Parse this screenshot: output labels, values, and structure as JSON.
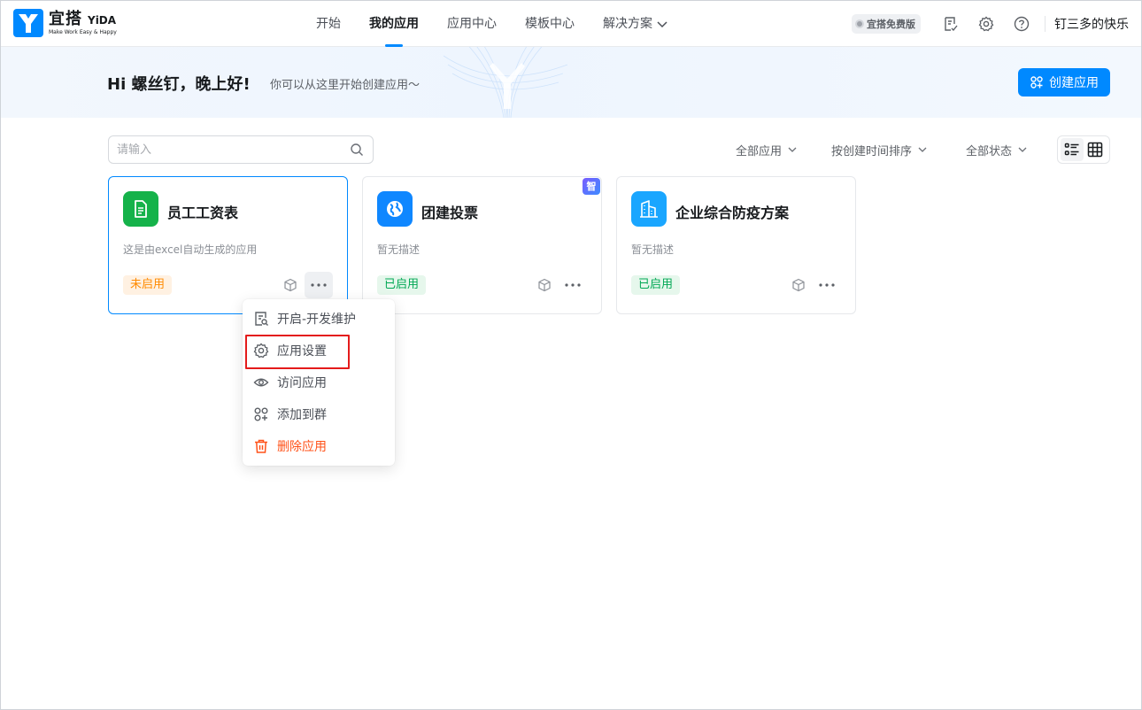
{
  "brand": {
    "name_cn": "宜搭",
    "name_en": "YiDA",
    "slogan": "Make Work Easy & Happy",
    "logo_icon": "yida-logo-icon",
    "accent_color": "#0089ff"
  },
  "nav": {
    "items": [
      {
        "label": "开始"
      },
      {
        "label": "我的应用"
      },
      {
        "label": "应用中心"
      },
      {
        "label": "模板中心"
      },
      {
        "label": "解决方案"
      }
    ],
    "active_index": 1
  },
  "topright": {
    "free_badge": "宜搭免费版",
    "icons": [
      "todo-icon",
      "settings-icon",
      "help-icon"
    ],
    "user_name": "钉三多的快乐"
  },
  "banner": {
    "greeting": "Hi 螺丝钉，晚上好!",
    "subtitle": "你可以从这里开始创建应用～",
    "create_button": "创建应用"
  },
  "toolbar": {
    "search_placeholder": "请输入",
    "filter_apps": "全部应用",
    "sort": "按创建时间排序",
    "filter_status": "全部状态",
    "view_modes": [
      "list-view-icon",
      "grid-view-icon"
    ],
    "active_view": "grid"
  },
  "apps": [
    {
      "name": "员工工资表",
      "description": "这是由excel自动生成的应用",
      "status": "未启用",
      "icon": "document-icon",
      "icon_color": "#15b24a"
    },
    {
      "name": "团建投票",
      "description": "暂无描述",
      "status": "已启用",
      "icon": "globe-icon",
      "icon_color": "#0f87ff",
      "ai_tag": "智"
    },
    {
      "name": "企业综合防疫方案",
      "description": "暂无描述",
      "status": "已启用",
      "icon": "building-icon",
      "icon_color": "#1aa6ff"
    }
  ],
  "context_menu": {
    "items": [
      {
        "label": "开启-开发维护",
        "icon": "dev-maintain-icon"
      },
      {
        "label": "应用设置",
        "icon": "gear-icon"
      },
      {
        "label": "访问应用",
        "icon": "eye-icon"
      },
      {
        "label": "添加到群",
        "icon": "add-group-icon"
      },
      {
        "label": "删除应用",
        "icon": "trash-icon"
      }
    ],
    "highlighted": "应用设置"
  }
}
